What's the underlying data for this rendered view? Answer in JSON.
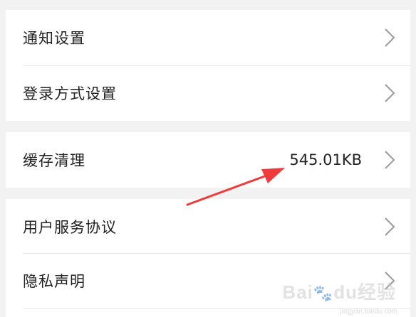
{
  "groups": [
    {
      "items": [
        {
          "label": "通知设置"
        },
        {
          "label": "登录方式设置"
        }
      ]
    },
    {
      "items": [
        {
          "label": "缓存清理",
          "value": "545.01KB"
        }
      ]
    },
    {
      "items": [
        {
          "label": "用户服务协议"
        },
        {
          "label": "隐私声明"
        }
      ]
    }
  ],
  "icons": {
    "chevron": "chevron-right-icon",
    "annotation": "red-arrow"
  },
  "colors": {
    "background": "#f2f2f2",
    "row_background": "#ffffff",
    "text": "#222222",
    "chevron": "#9a9a9a",
    "annotation_arrow": "#ee3b3b"
  },
  "watermark": {
    "text": "Baidu经验",
    "sub": "jingyan.baidu.com"
  }
}
